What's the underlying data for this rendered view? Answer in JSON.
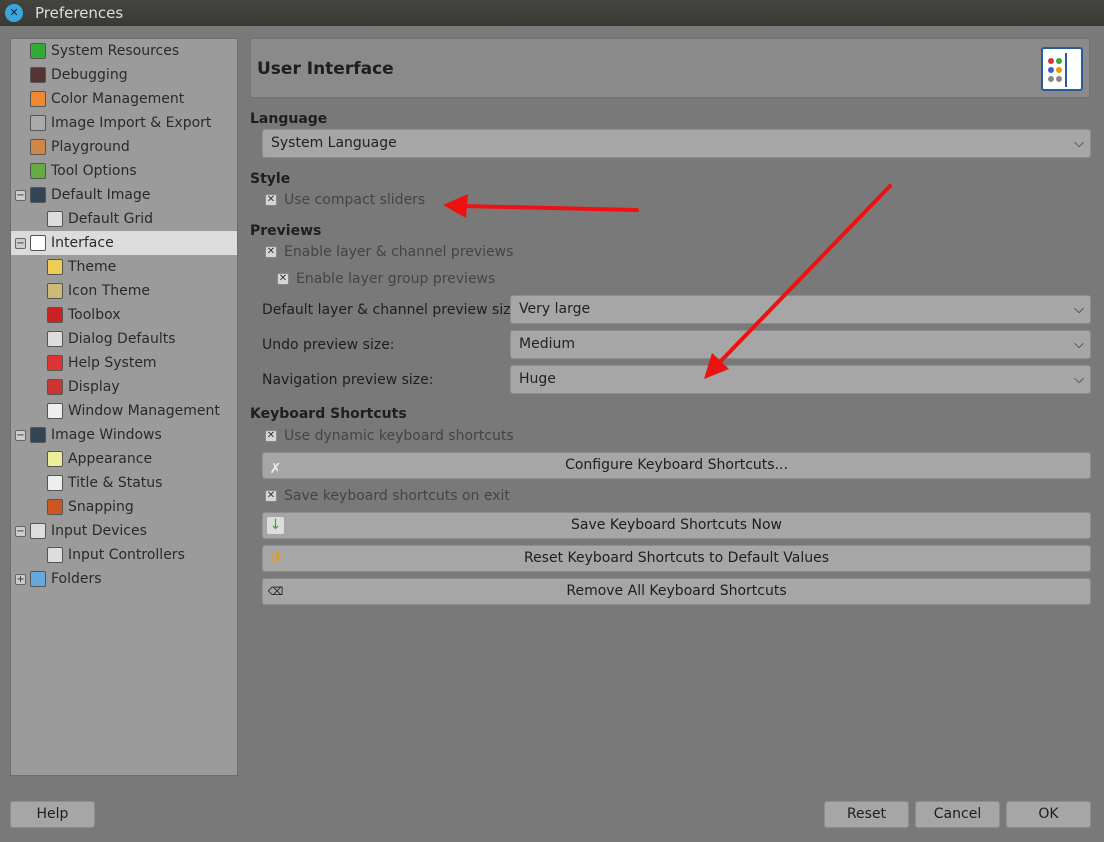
{
  "window": {
    "title": "Preferences"
  },
  "sidebar": {
    "items": [
      {
        "label": "System Resources",
        "level": 0,
        "icon": "system-resources-icon",
        "color": "#3a3"
      },
      {
        "label": "Debugging",
        "level": 0,
        "icon": "debugging-icon",
        "color": "#533"
      },
      {
        "label": "Color Management",
        "level": 0,
        "icon": "color-management-icon",
        "color": "#e83"
      },
      {
        "label": "Image Import & Export",
        "level": 0,
        "icon": "image-import-export-icon",
        "color": "#aaa"
      },
      {
        "label": "Playground",
        "level": 0,
        "icon": "playground-icon",
        "color": "#c84"
      },
      {
        "label": "Tool Options",
        "level": 0,
        "icon": "tool-options-icon",
        "color": "#6a4"
      },
      {
        "label": "Default Image",
        "level": 0,
        "icon": "default-image-icon",
        "color": "#345",
        "expander": "−"
      },
      {
        "label": "Default Grid",
        "level": 1,
        "icon": "default-grid-icon",
        "color": "#ddd"
      },
      {
        "label": "Interface",
        "level": 0,
        "icon": "interface-icon",
        "color": "#fff",
        "expander": "−",
        "selected": true
      },
      {
        "label": "Theme",
        "level": 1,
        "icon": "theme-icon",
        "color": "#ec5"
      },
      {
        "label": "Icon Theme",
        "level": 1,
        "icon": "icon-theme-icon",
        "color": "#cb7"
      },
      {
        "label": "Toolbox",
        "level": 1,
        "icon": "toolbox-icon",
        "color": "#c22"
      },
      {
        "label": "Dialog Defaults",
        "level": 1,
        "icon": "dialog-defaults-icon",
        "color": "#ddd"
      },
      {
        "label": "Help System",
        "level": 1,
        "icon": "help-system-icon",
        "color": "#d33"
      },
      {
        "label": "Display",
        "level": 1,
        "icon": "display-icon",
        "color": "#c33"
      },
      {
        "label": "Window Management",
        "level": 1,
        "icon": "window-management-icon",
        "color": "#eee"
      },
      {
        "label": "Image Windows",
        "level": 0,
        "icon": "image-windows-icon",
        "color": "#345",
        "expander": "−"
      },
      {
        "label": "Appearance",
        "level": 1,
        "icon": "appearance-icon",
        "color": "#ee9"
      },
      {
        "label": "Title & Status",
        "level": 1,
        "icon": "title-status-icon",
        "color": "#eee"
      },
      {
        "label": "Snapping",
        "level": 1,
        "icon": "snapping-icon",
        "color": "#c52"
      },
      {
        "label": "Input Devices",
        "level": 0,
        "icon": "input-devices-icon",
        "color": "#ddd",
        "expander": "−"
      },
      {
        "label": "Input Controllers",
        "level": 1,
        "icon": "input-controllers-icon",
        "color": "#ddd"
      },
      {
        "label": "Folders",
        "level": 0,
        "icon": "folders-icon",
        "color": "#6ad",
        "expander": "+"
      }
    ]
  },
  "main": {
    "title": "User Interface",
    "language": {
      "heading": "Language",
      "value": "System Language"
    },
    "style": {
      "heading": "Style",
      "compact_sliders": "Use compact sliders"
    },
    "previews": {
      "heading": "Previews",
      "layer_channel": "Enable layer & channel previews",
      "layer_group": "Enable layer group previews",
      "default_size_label": "Default layer & channel preview size:",
      "default_size": "Very large",
      "undo_label": "Undo preview size:",
      "undo_size": "Medium",
      "nav_label": "Navigation preview size:",
      "nav_size": "Huge"
    },
    "shortcuts": {
      "heading": "Keyboard Shortcuts",
      "dynamic": "Use dynamic keyboard shortcuts",
      "configure": "Configure Keyboard Shortcuts...",
      "save_on_exit": "Save keyboard shortcuts on exit",
      "save_now": "Save Keyboard Shortcuts Now",
      "reset": "Reset Keyboard Shortcuts to Default Values",
      "remove": "Remove All Keyboard Shortcuts"
    }
  },
  "footer": {
    "help": "Help",
    "reset": "Reset",
    "cancel": "Cancel",
    "ok": "OK"
  },
  "annotation": {
    "arrow_color": "#ee1111"
  }
}
